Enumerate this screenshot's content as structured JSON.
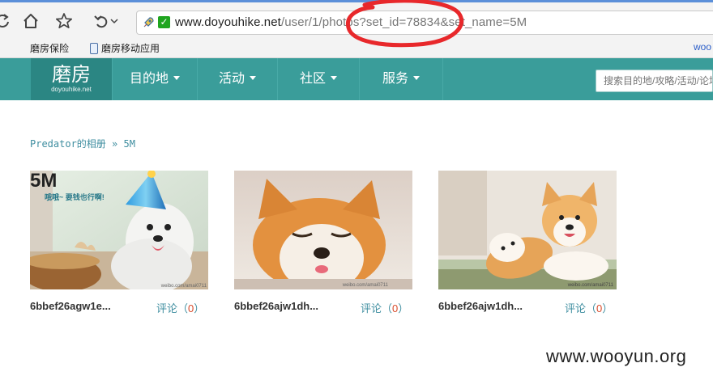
{
  "browser": {
    "url_host": "www.doyouhike.net",
    "url_rest": "/user/1/photos?set_id=78834&set_name=5M",
    "annotation_color": "#e8282b"
  },
  "bookmarks": {
    "items": [
      {
        "label": "磨房保险"
      },
      {
        "label": "磨房移动应用"
      }
    ],
    "overflow": "woo"
  },
  "site": {
    "logo_cn": "磨房",
    "logo_en": "doyouhike.net",
    "nav": [
      "目的地",
      "活动",
      "社区",
      "服务"
    ],
    "search_placeholder": "搜索目的地/攻略/活动/论坛",
    "brand_color": "#3a9d9a"
  },
  "breadcrumb": {
    "owner": "Predator的相册",
    "sep": "»",
    "album": "5M"
  },
  "photos": [
    {
      "caption": "6bbef26agw1e...",
      "comment_label": "评论",
      "comment_open": "（",
      "comment_count": "0",
      "comment_close": "）",
      "overlay_badge": "5M",
      "overlay_text": "哦哦~ 要钱也行啊!"
    },
    {
      "caption": "6bbef26ajw1dh...",
      "comment_label": "评论",
      "comment_open": "（",
      "comment_count": "0",
      "comment_close": "）"
    },
    {
      "caption": "6bbef26ajw1dh...",
      "comment_label": "评论",
      "comment_open": "（",
      "comment_count": "0",
      "comment_close": "）"
    }
  ],
  "photo_credit": "weibo.com/amai0711",
  "watermark": "www.wooyun.org"
}
